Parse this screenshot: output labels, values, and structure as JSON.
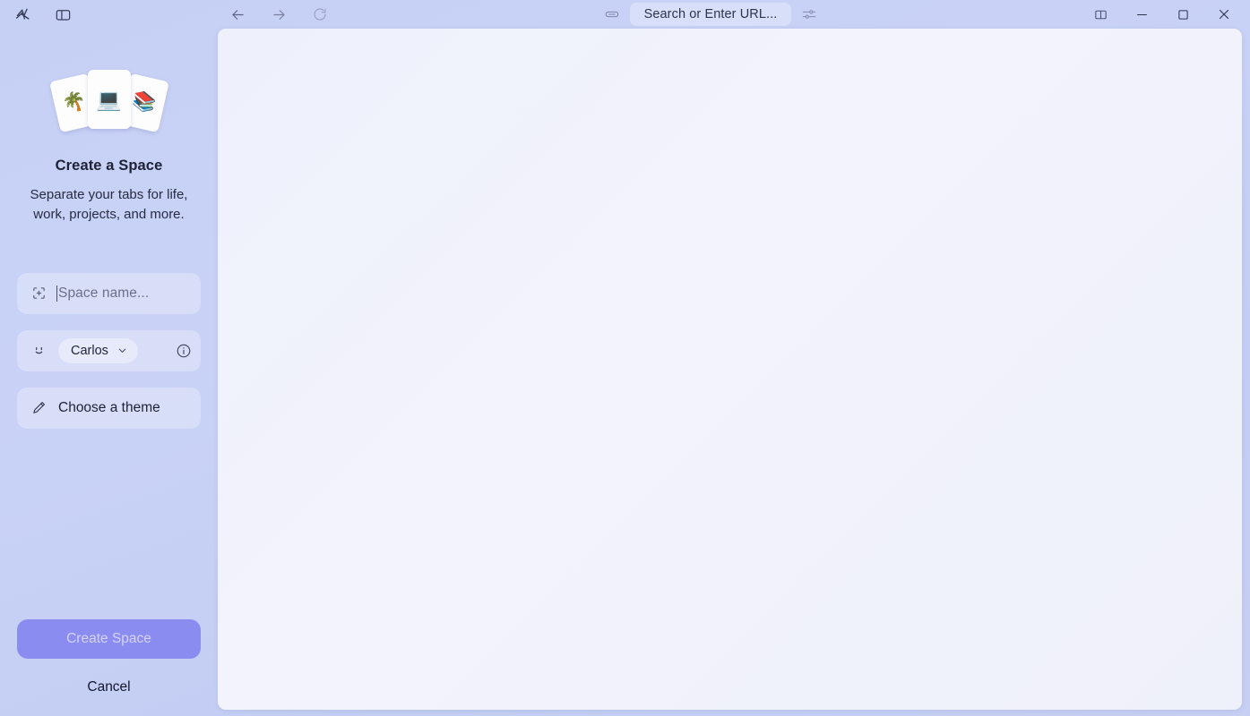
{
  "titlebar": {
    "logo_icon": "app-logo-icon",
    "sidebar_toggle_icon": "sidebar-toggle-icon",
    "back_icon": "arrow-left-icon",
    "forward_icon": "arrow-right-icon",
    "reload_icon": "reload-icon",
    "link_icon": "link-icon",
    "url_placeholder": "Search or Enter URL...",
    "tune_icon": "sliders-icon",
    "split_view_icon": "split-view-icon",
    "minimize_icon": "minimize-icon",
    "maximize_icon": "maximize-icon",
    "close_icon": "close-icon"
  },
  "sidebar": {
    "illustration": {
      "left_card_emoji": "🌴",
      "center_card_emoji": "💻",
      "right_card_emoji": "📚"
    },
    "title": "Create a Space",
    "subtitle": "Separate your tabs for life, work, projects, and more.",
    "space_name": {
      "icon": "add-square-icon",
      "placeholder": "Space name...",
      "value": ""
    },
    "profile": {
      "icon": "smiley-face-icon",
      "name": "Carlos",
      "chevron_icon": "chevron-down-icon",
      "info_icon": "info-icon"
    },
    "theme": {
      "icon": "paintbrush-icon",
      "label": "Choose a theme"
    },
    "create_button": "Create Space",
    "cancel_button": "Cancel"
  },
  "colors": {
    "accent": "#8b8cf0",
    "sidebar_bg": "#c8d1f5",
    "content_bg": "#eef1fc",
    "text_primary": "#1d2235",
    "text_muted": "#6c7089"
  }
}
